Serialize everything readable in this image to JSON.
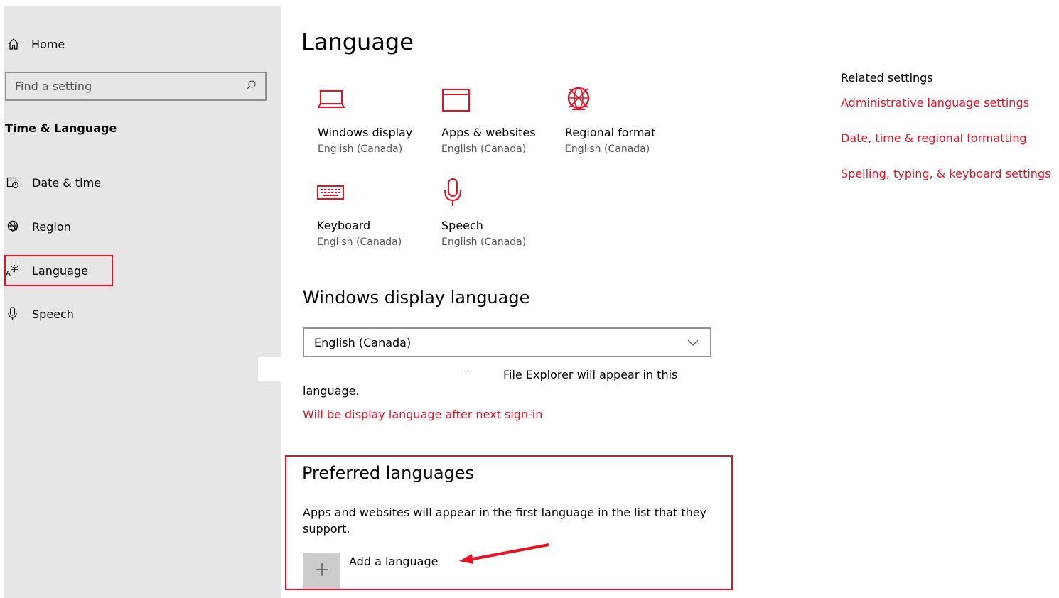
{
  "sidebar": {
    "home_label": "Home",
    "search_placeholder": "Find a setting",
    "section_title": "Time & Language",
    "items": [
      {
        "label": "Date & time",
        "icon": "calendar-clock-icon"
      },
      {
        "label": "Region",
        "icon": "globe-icon"
      },
      {
        "label": "Language",
        "icon": "language-icon"
      },
      {
        "label": "Speech",
        "icon": "microphone-icon"
      }
    ],
    "selected": "Language"
  },
  "main": {
    "title": "Language",
    "tiles": [
      {
        "label": "Windows display",
        "sub": "English (Canada)",
        "icon": "laptop-icon"
      },
      {
        "label": "Apps & websites",
        "sub": "English (Canada)",
        "icon": "window-icon"
      },
      {
        "label": "Regional format",
        "sub": "English (Canada)",
        "icon": "globe-icon"
      },
      {
        "label": "Keyboard",
        "sub": "English (Canada)",
        "icon": "keyboard-icon"
      },
      {
        "label": "Speech",
        "sub": "English (Canada)",
        "icon": "microphone-icon"
      }
    ],
    "display_language": {
      "heading": "Windows display language",
      "selected_value": "English (Canada)",
      "description_line1_fragment": "File Explorer will appear in this",
      "description_line2": "language.",
      "notice": "Will be display language after next sign-in"
    },
    "preferred": {
      "heading": "Preferred languages",
      "description_line1": "Apps and websites will appear in the first language in the list that they",
      "description_line2": "support.",
      "add_label": "Add a language"
    }
  },
  "related": {
    "title": "Related settings",
    "links": [
      "Administrative language settings",
      "Date, time & regional formatting",
      "Spelling, typing, & keyboard settings"
    ]
  },
  "colors": {
    "accent": "#e81123",
    "sidebar_bg": "#e6e6e6",
    "button_bg": "#cccccc"
  }
}
